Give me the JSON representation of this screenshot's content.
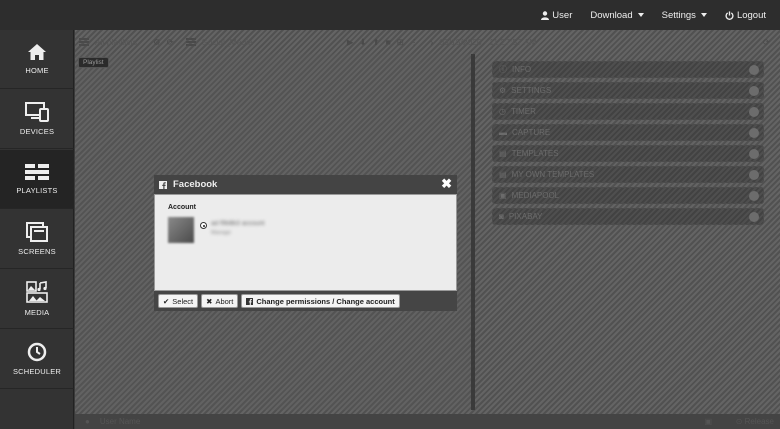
{
  "topnav": {
    "user": "User",
    "download": "Download",
    "settings": "Settings",
    "logout": "Logout"
  },
  "sidebar": {
    "items": [
      {
        "label": "HOME",
        "icon": "home-icon"
      },
      {
        "label": "DEVICES",
        "icon": "devices-icon"
      },
      {
        "label": "PLAYLISTS",
        "icon": "playlists-icon",
        "active": true
      },
      {
        "label": "SCREENS",
        "icon": "screens-icon"
      },
      {
        "label": "MEDIA",
        "icon": "media-icon"
      },
      {
        "label": "SCHEDULER",
        "icon": "clock-icon"
      }
    ]
  },
  "toolbar": {
    "all_playlists": "All playlists",
    "playlist_name": "Social_Media",
    "datetime": "03/18/2020 · 11:27:57 AM"
  },
  "preview_tag": "Playlist",
  "accordion": {
    "items": [
      "INFO",
      "SETTINGS",
      "TIMER",
      "CAPTURE",
      "TEMPLATES",
      "MY OWN TEMPLATES",
      "MEDIAPOOL",
      "PIXABAY"
    ]
  },
  "bottom": {
    "username_placeholder": "User Name",
    "release": "Release"
  },
  "modal": {
    "title": "Facebook",
    "account_label": "Account",
    "account_name": "ad f9b8b3 account",
    "account_sub": "Manage",
    "buttons": {
      "select": "Select",
      "abort": "Abort",
      "change": "Change permissions / Change account"
    }
  },
  "colors": {
    "topbar": "#2d2d2d",
    "sidebar": "#333333",
    "sidebar_active": "#242424",
    "modal_body": "#ececec"
  }
}
